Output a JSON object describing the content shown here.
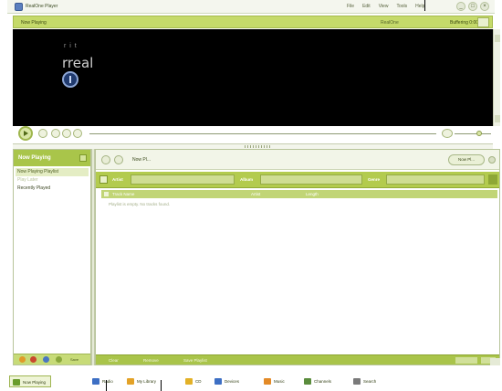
{
  "window": {
    "title": "RealOne Player",
    "menu": [
      "File",
      "Edit",
      "View",
      "Tools",
      "Help"
    ],
    "controls": [
      "_",
      "□",
      "×"
    ]
  },
  "now_playing": {
    "label": "Now Playing",
    "mid": "RealOne",
    "right": "Buffering 0:00"
  },
  "video": {
    "line1": "r i t",
    "line2": "rreal",
    "logo_icon": "realone-logo-icon"
  },
  "transport": {
    "play_icon": "play-icon",
    "divider_label": "Collapse"
  },
  "left_panel": {
    "title": "Now Playing",
    "items": [
      {
        "label": "Now Playing Playlist",
        "state": "selected"
      },
      {
        "label": "Play Later",
        "state": "dim"
      },
      {
        "label": "Recently Played",
        "state": "normal"
      }
    ],
    "foot_label": "Save"
  },
  "main": {
    "title": "Now Pl...",
    "right_button": "Now Pl...",
    "filter": {
      "label1": "Artist",
      "label2": "Album",
      "label3": "Genre"
    },
    "columns": [
      "Track Name",
      "Artist",
      "Length"
    ],
    "empty_message": "Playlist is empty. No tracks found.",
    "status": [
      "Clear",
      "Remove",
      "Save Playlist"
    ]
  },
  "tabs": [
    {
      "label": "Now Playing",
      "icon": "now-playing-icon",
      "color": "#6a9c2c",
      "active": true
    },
    {
      "label": "Radio",
      "icon": "radio-icon",
      "color": "#3d6fc4",
      "active": false
    },
    {
      "label": "My Library",
      "icon": "library-icon",
      "color": "#e3a227",
      "active": false
    },
    {
      "label": "CD",
      "icon": "cd-icon",
      "color": "#e3b127",
      "active": false
    },
    {
      "label": "Devices",
      "icon": "devices-icon",
      "color": "#3d6fc4",
      "active": false
    },
    {
      "label": "Music",
      "icon": "music-icon",
      "color": "#e38a27",
      "active": false
    },
    {
      "label": "Channels",
      "icon": "channels-icon",
      "color": "#5a8c3c",
      "active": false
    },
    {
      "label": "Search",
      "icon": "search-icon",
      "color": "#7a7a7a",
      "active": false
    }
  ],
  "colors": {
    "accent": "#a9c54a",
    "strip": "#c5da6a",
    "video_bg": "#000000"
  }
}
